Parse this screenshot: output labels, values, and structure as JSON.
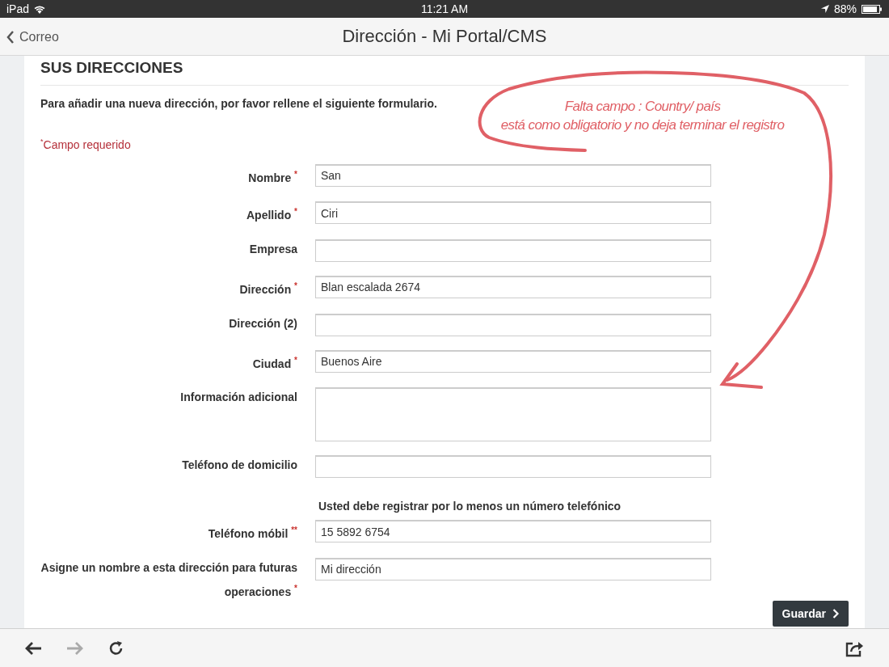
{
  "status_bar": {
    "device": "iPad",
    "time": "11:21 AM",
    "battery": "88%"
  },
  "nav_bar": {
    "back": "Correo",
    "title": "Dirección - Mi Portal/CMS"
  },
  "section": {
    "title": "SUS DIRECCIONES",
    "intro": "Para añadir una nueva dirección, por favor rellene el siguiente formulario.",
    "required_mark": "*",
    "required_note": "Campo requerido"
  },
  "fields": [
    {
      "kind": "input",
      "label": "Nombre",
      "required": "*",
      "value": "San"
    },
    {
      "kind": "input",
      "label": "Apellido",
      "required": "*",
      "value": "Ciri"
    },
    {
      "kind": "input",
      "label": "Empresa"
    },
    {
      "kind": "input",
      "label": "Dirección",
      "required": "*",
      "value": "Blan escalada 2674"
    },
    {
      "kind": "input",
      "label": "Dirección (2)"
    },
    {
      "kind": "input",
      "label": "Ciudad",
      "required": "*",
      "value": "Buenos Aire"
    },
    {
      "kind": "textarea",
      "label": "Información adicional"
    },
    {
      "kind": "input",
      "label": "Teléfono de domicilio"
    },
    {
      "kind": "note",
      "text": "Usted debe registrar por lo menos un número telefónico"
    },
    {
      "kind": "input",
      "label": "Teléfono móbil",
      "required": "**",
      "value": "15 5892 6754"
    },
    {
      "kind": "input",
      "label": "Asigne un nombre a esta dirección para futuras operaciones",
      "required": "*",
      "value": "Mi dirección"
    }
  ],
  "save_button": "Guardar",
  "annotation": {
    "lines": [
      "Falta campo : Country/ país",
      "está como obligatorio y no deja terminar el registro"
    ]
  },
  "toolbar": {
    "forward_disabled": true
  }
}
